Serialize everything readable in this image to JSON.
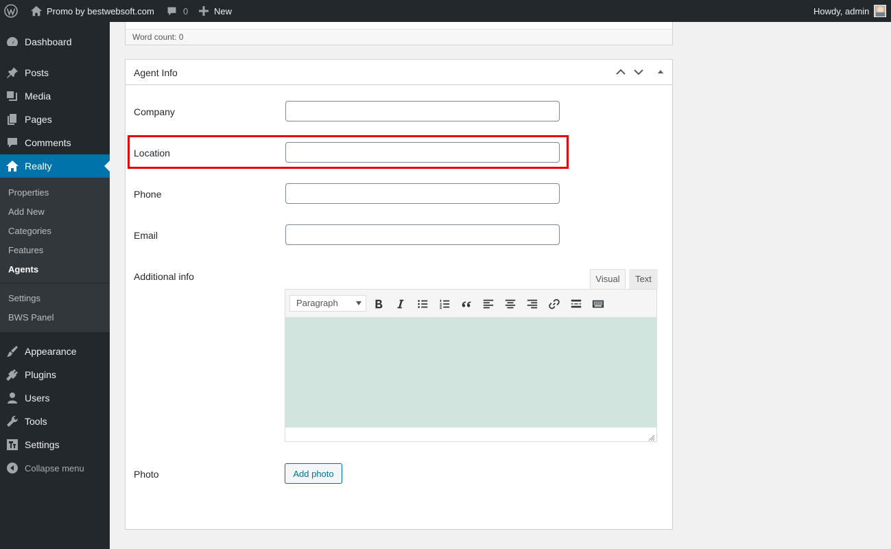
{
  "adminbar": {
    "site_name": "Promo by bestwebsoft.com",
    "comments_count": "0",
    "new_label": "New",
    "howdy": "Howdy, admin"
  },
  "sidebar": {
    "items": [
      {
        "label": "Dashboard",
        "icon": "dashboard-icon"
      },
      {
        "label": "Posts",
        "icon": "pin-icon"
      },
      {
        "label": "Media",
        "icon": "media-icon"
      },
      {
        "label": "Pages",
        "icon": "pages-icon"
      },
      {
        "label": "Comments",
        "icon": "comment-icon"
      },
      {
        "label": "Realty",
        "icon": "home-icon",
        "current": true
      }
    ],
    "submenu": [
      {
        "label": "Properties"
      },
      {
        "label": "Add New"
      },
      {
        "label": "Categories"
      },
      {
        "label": "Features"
      },
      {
        "label": "Agents",
        "current": true
      },
      {
        "label": "Settings"
      },
      {
        "label": "BWS Panel"
      }
    ],
    "items_bottom": [
      {
        "label": "Appearance",
        "icon": "brush-icon"
      },
      {
        "label": "Plugins",
        "icon": "plug-icon"
      },
      {
        "label": "Users",
        "icon": "user-icon"
      },
      {
        "label": "Tools",
        "icon": "wrench-icon"
      },
      {
        "label": "Settings",
        "icon": "settings-icon"
      }
    ],
    "collapse_label": "Collapse menu"
  },
  "wordcount": {
    "label": "Word count: 0"
  },
  "metabox": {
    "title": "Agent Info",
    "fields": [
      {
        "label": "Company",
        "value": ""
      },
      {
        "label": "Location",
        "value": ""
      },
      {
        "label": "Phone",
        "value": ""
      },
      {
        "label": "Email",
        "value": ""
      }
    ],
    "additional_label": "Additional info",
    "editor": {
      "tab_visual": "Visual",
      "tab_text": "Text",
      "format_value": "Paragraph"
    },
    "photo_label": "Photo",
    "add_photo_label": "Add photo"
  },
  "colors": {
    "admin_dark": "#23282d",
    "accent": "#0073aa",
    "highlight": "#e10000",
    "editor_bg": "#d2e4de"
  }
}
